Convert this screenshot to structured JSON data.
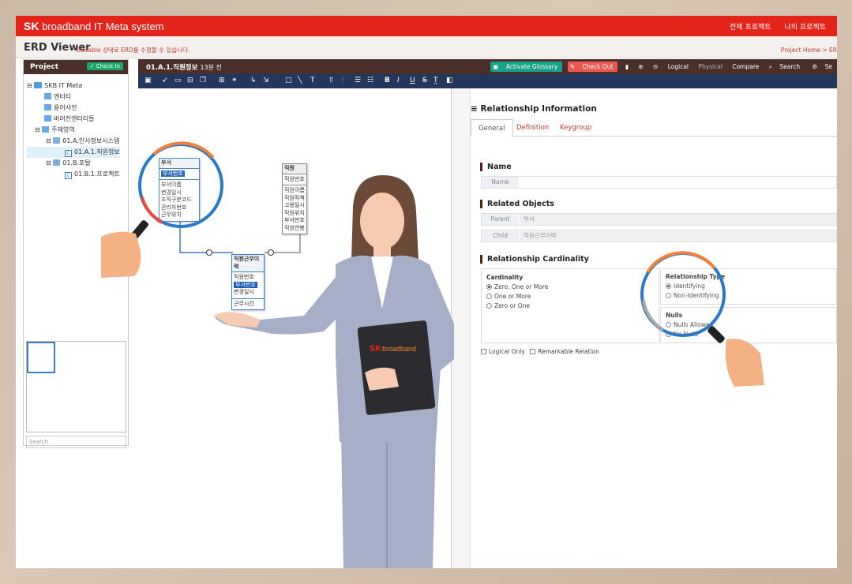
{
  "app": {
    "brand_sk": "SK",
    "brand_rest": "broadband IT Meta system"
  },
  "topnav": [
    "전체 프로젝트",
    "나의 프로젝트"
  ],
  "title": {
    "main": "ERD Viewer",
    "sub": "Editable 상태로 ERD를 수정할 수 있습니다.",
    "breadcrumb": "Project Home > ER"
  },
  "project_panel": {
    "header": "Project",
    "checkin": "Check In",
    "tree": [
      "SKB IT Meta",
      "엔터티",
      "용어사전",
      "버려진엔터티들",
      "주제영역",
      "01.A.인사정보시스템",
      "01.A.1.직원정보",
      "01.B.포탈",
      "01.B.1.프로젝트"
    ],
    "search_placeholder": "Search"
  },
  "editor": {
    "name": "01.A.1.직원정보",
    "time": "13분 전",
    "activate_glossary": "Activate Glossary",
    "checkout": "Check Out",
    "logical": "Logical",
    "physical": "Physical",
    "compare": "Compare",
    "search": "Search",
    "settings_cut": "Se"
  },
  "entities": {
    "bu": {
      "title": "부서",
      "pk": [
        "부서번호"
      ],
      "attrs": [
        "부서이름",
        "변경일시",
        "조직구분코드",
        "관리자번호",
        "근무위치"
      ]
    },
    "jw": {
      "title": "직원",
      "pk": [
        "직원번호"
      ],
      "attrs": [
        "직원이름",
        "직원직책",
        "고용일시",
        "직원위치",
        "부서번호",
        "직원연봉"
      ]
    },
    "jg": {
      "title": "직원근무이력",
      "pk": [
        "직원번호",
        "부서번호",
        "변경일시"
      ],
      "attrs": [
        "근무시간"
      ]
    }
  },
  "rel_panel": {
    "title": "Relationship Information",
    "tabs": [
      "General",
      "Definition",
      "Keygroup"
    ],
    "name_section": "Name",
    "name_label": "Name",
    "name_value": "",
    "related_section": "Related Objects",
    "parent_label": "Parent",
    "parent_value": "부서",
    "child_label": "Child",
    "child_value": "직원근무이력",
    "card_section": "Relationship Cardinality",
    "cardinality_title": "Cardinality",
    "cardinality_opts": [
      "Zero, One or More",
      "One or More",
      "Zero or One"
    ],
    "reltype_title": "Relationship Type",
    "reltype_opts": [
      "Identifying",
      "Non-Identifying"
    ],
    "nulls_title": "Nulls",
    "nulls_opts": [
      "Nulls Allowed",
      "No Nulls"
    ],
    "logical_only": "Logical Only",
    "remarkable": "Remarkable Relation"
  },
  "clipboard_text_sk": "SK",
  "clipboard_text_rest": "broadband",
  "colors": {
    "brand_red": "#e3241b",
    "dark_brown": "#4a2f2a",
    "navy": "#23365c",
    "suit": "#a7aec8",
    "link_red": "#c43a2f"
  }
}
